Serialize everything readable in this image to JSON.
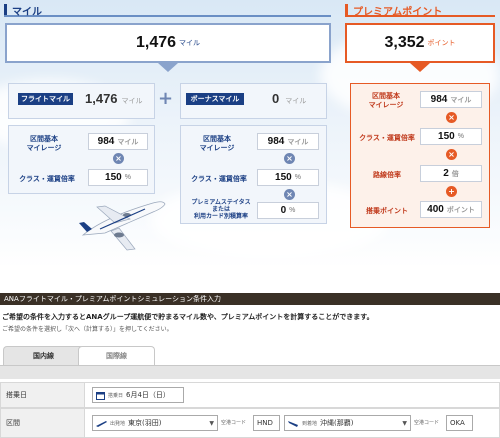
{
  "colors": {
    "accent_blue": "#1b3f84",
    "accent_orange": "#e65a25"
  },
  "mile": {
    "header": "マイル",
    "total": "1,476",
    "unit": "マイル"
  },
  "premium": {
    "header": "プレミアムポイント",
    "total": "3,352",
    "unit": "ポイント",
    "rows": [
      {
        "label": "区間基本\nマイレージ",
        "value": "984",
        "unit": "マイル"
      },
      {
        "label": "クラス・運賃倍率",
        "value": "150",
        "unit": "%"
      },
      {
        "label": "路線倍率",
        "value": "2",
        "unit": "倍"
      },
      {
        "label": "搭乗ポイント",
        "value": "400",
        "unit": "ポイント"
      }
    ]
  },
  "flight": {
    "label": "フライトマイル",
    "value": "1,476",
    "unit": "マイル",
    "rows": [
      {
        "label": "区間基本\nマイレージ",
        "value": "984",
        "unit": "マイル"
      },
      {
        "label": "クラス・運賃倍率",
        "value": "150",
        "unit": "%"
      }
    ]
  },
  "bonus": {
    "label": "ボーナスマイル",
    "value": "0",
    "unit": "マイル",
    "rows": [
      {
        "label": "区間基本\nマイレージ",
        "value": "984",
        "unit": "マイル"
      },
      {
        "label": "クラス・運賃倍率",
        "value": "150",
        "unit": "%"
      },
      {
        "label": "プレミアムステイタス\nまたは\n利用カード別積算率",
        "value": "0",
        "unit": "%"
      }
    ]
  },
  "section_title": "ANAフライトマイル・プレミアムポイントシミュレーション条件入力",
  "intro": "ご希望の条件を入力するとANAグループ運航便で貯まるマイル数や、プレミアムポイントを計算することができます。",
  "sub": "ご希望の条件を選択し「次へ（計算する）」を押してください。",
  "tabs": [
    "国内線",
    "国際線"
  ],
  "form": {
    "date_label": "搭乗日",
    "date_sub": "搭乗日",
    "date_value": "6月4日（日）",
    "route_label": "区間",
    "dep_sub": "出発地",
    "dep_value": "東京(羽田)",
    "code_label": "空港コード",
    "dep_code": "HND",
    "arr_sub": "到着地",
    "arr_value": "沖縄(那覇)",
    "arr_code": "OKA"
  }
}
